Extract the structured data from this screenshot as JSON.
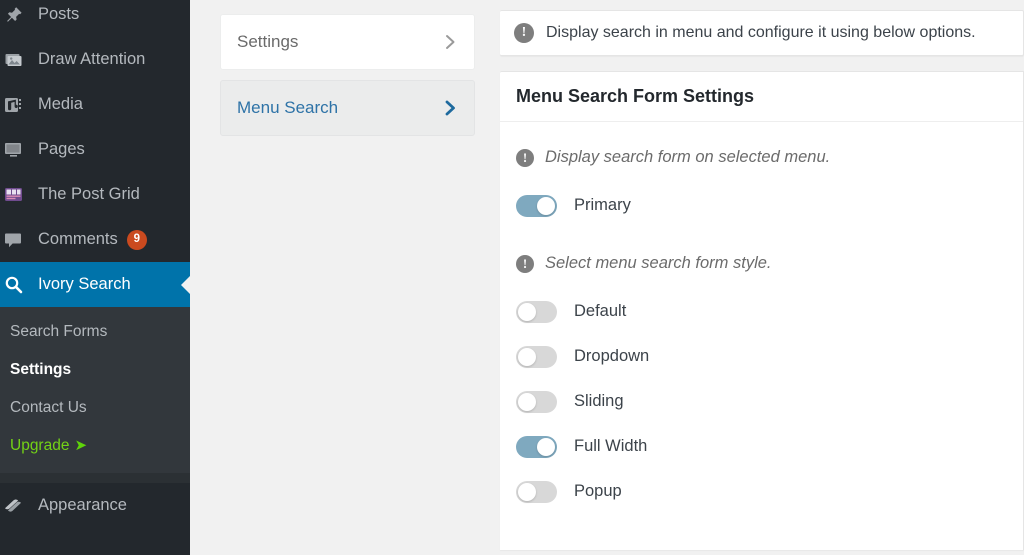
{
  "sidebar": {
    "items": [
      {
        "label": "Posts",
        "icon": "pin-icon",
        "current": false
      },
      {
        "label": "Draw Attention",
        "icon": "image-icon",
        "current": false
      },
      {
        "label": "Media",
        "icon": "media-icon",
        "current": false
      },
      {
        "label": "Pages",
        "icon": "page-icon",
        "current": false
      },
      {
        "label": "The Post Grid",
        "icon": "grid-icon",
        "current": false
      },
      {
        "label": "Comments",
        "icon": "comment-icon",
        "current": false,
        "badge": "9"
      },
      {
        "label": "Ivory Search",
        "icon": "magnifier-icon",
        "current": true
      },
      {
        "label": "Appearance",
        "icon": "appearance-icon",
        "current": false
      }
    ],
    "submenu": [
      {
        "label": "Search Forms",
        "current": false,
        "upgrade": false
      },
      {
        "label": "Settings",
        "current": true,
        "upgrade": false
      },
      {
        "label": "Contact Us",
        "current": false,
        "upgrade": false
      },
      {
        "label": "Upgrade",
        "current": false,
        "upgrade": true,
        "arrow": "➤"
      }
    ],
    "colors": {
      "background": "#23282d",
      "submenu_background": "#32373c",
      "current_background": "#0073aa",
      "badge_background": "#ca4a1f",
      "upgrade_text": "#73d216"
    }
  },
  "tabs": [
    {
      "label": "Settings",
      "active": false,
      "icon": "chevron-right-icon"
    },
    {
      "label": "Menu Search",
      "active": true,
      "icon": "chevron-right-icon"
    }
  ],
  "notice": {
    "icon": "info-icon",
    "text": "Display search in menu and configure it using below options."
  },
  "panel": {
    "title": "Menu Search Form Settings",
    "groups": [
      {
        "icon": "info-icon",
        "description": "Display search form on selected menu.",
        "toggles": [
          {
            "label": "Primary",
            "on": true
          }
        ]
      },
      {
        "icon": "info-icon",
        "description": "Select menu search form style.",
        "toggles": [
          {
            "label": "Default",
            "on": false
          },
          {
            "label": "Dropdown",
            "on": false
          },
          {
            "label": "Sliding",
            "on": false
          },
          {
            "label": "Full Width",
            "on": true
          },
          {
            "label": "Popup",
            "on": false
          }
        ]
      }
    ],
    "colors": {
      "toggle_on": "#7fa9bf",
      "toggle_off": "#d8d8d8",
      "accent_link": "#2e73a7"
    }
  }
}
